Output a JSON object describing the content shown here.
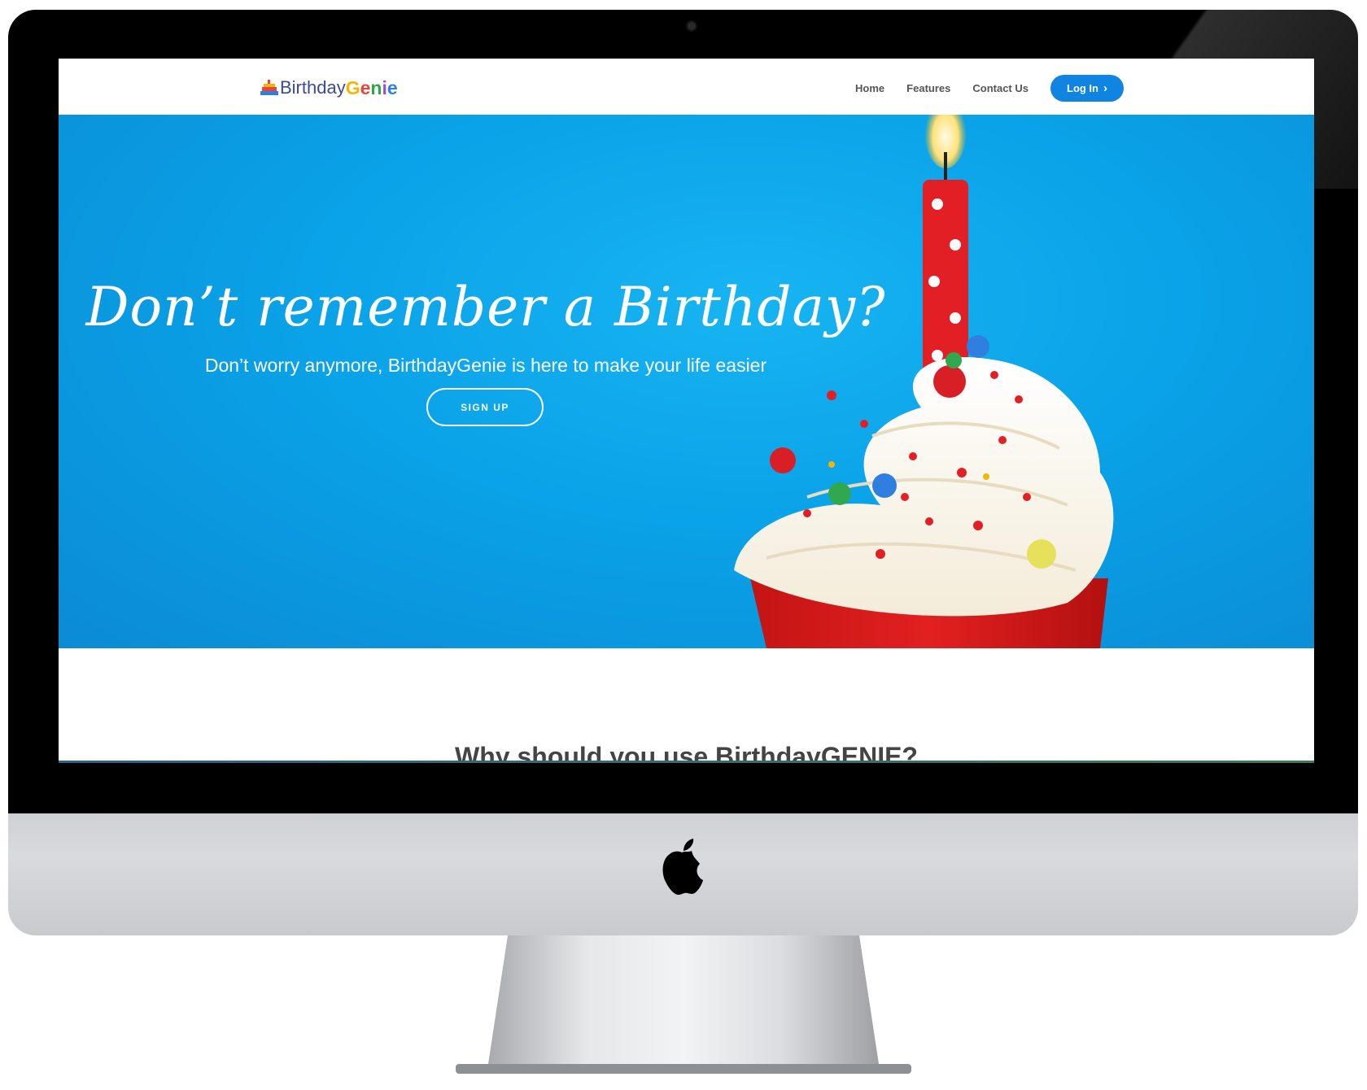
{
  "brand": {
    "name_part1": "Birthday",
    "name_part2_letters": [
      {
        "ch": "G",
        "color": "#f2b705"
      },
      {
        "ch": "e",
        "color": "#e8453c"
      },
      {
        "ch": "n",
        "color": "#2ba84a"
      },
      {
        "ch": "i",
        "color": "#9b4fd1"
      },
      {
        "ch": "e",
        "color": "#2f7fe0"
      }
    ]
  },
  "nav": {
    "home": "Home",
    "features": "Features",
    "contact": "Contact Us",
    "login": "Log In",
    "login_icon": "chevron-right-icon",
    "login_color": "#0f84e0"
  },
  "hero": {
    "title": "Don’t remember a Birthday?",
    "subtitle": "Don’t worry anymore, BirthdayGenie is here to make your life easier",
    "cta": "SIGN UP",
    "background_color": "#0aa2e8"
  },
  "section": {
    "title": "Why should you use BirthdayGENIE?"
  },
  "device": {
    "logo_icon": "apple-logo-icon"
  }
}
